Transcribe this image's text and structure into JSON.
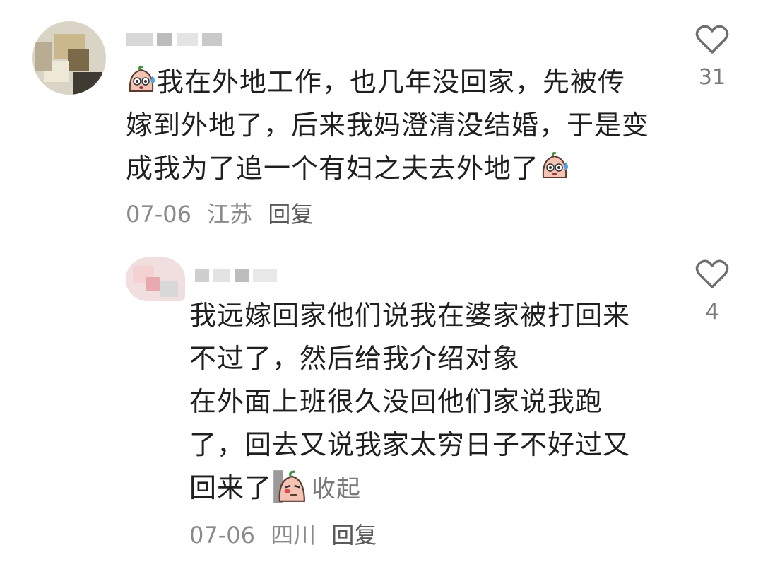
{
  "comments": [
    {
      "lines": [
        "我在外地工作，也几年没回家，先被传",
        "嫁到外地了，后来我妈澄清没结婚，于是变",
        "成我为了追一个有妇之夫去外地了"
      ],
      "date": "07-06",
      "location": "江苏",
      "reply_label": "回复",
      "like_count": "31",
      "leading_emoji": "sweat-emoji",
      "trailing_emoji": "sweat-emoji"
    },
    {
      "lines": [
        "我远嫁回家他们说我在婆家被打回来",
        "不过了，然后给我介绍对象",
        "在外面上班很久没回他们家说我跑",
        "了，回去又说我家太穷日子不好过又",
        "回来了"
      ],
      "collapse_label": "收起",
      "date": "07-06",
      "location": "四川",
      "reply_label": "回复",
      "like_count": "4",
      "trailing_emoji": "peek-emoji"
    }
  ],
  "colors": {
    "text": "#1f1f1f",
    "meta": "#8a8a8a",
    "icon": "#6f6f6f"
  },
  "icons": {
    "like": "heart-outline-icon"
  }
}
